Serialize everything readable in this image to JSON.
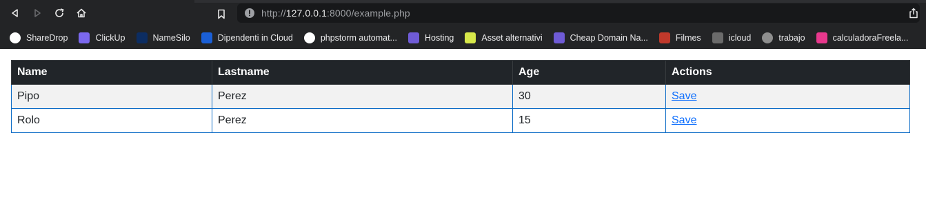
{
  "browser": {
    "url_scheme": "http://",
    "url_host": "127.0.0.1",
    "url_path": ":8000/example.php"
  },
  "bookmarks": [
    {
      "label": "ShareDrop",
      "icon": "sharedrop-icon",
      "color": "#ffffff"
    },
    {
      "label": "ClickUp",
      "icon": "clickup-icon",
      "color": "#7b68ee"
    },
    {
      "label": "NameSilo",
      "icon": "namesilo-icon",
      "color": "#0c2d62"
    },
    {
      "label": "Dipendenti in Cloud",
      "icon": "cloud-icon",
      "color": "#1a5fd6"
    },
    {
      "label": "phpstorm automat...",
      "icon": "google-icon",
      "color": "#ffffff"
    },
    {
      "label": "Hosting",
      "icon": "infinity-icon",
      "color": "#6f5bd6"
    },
    {
      "label": "Asset alternativi",
      "icon": "id-icon",
      "color": "#d7e84a"
    },
    {
      "label": "Cheap Domain Na...",
      "icon": "infinity-icon",
      "color": "#6f5bd6"
    },
    {
      "label": "Filmes",
      "icon": "filmes-icon",
      "color": "#c0392b"
    },
    {
      "label": "icloud",
      "icon": "icloud-photo-icon",
      "color": "#6b6b6b"
    },
    {
      "label": "trabajo",
      "icon": "globe-icon",
      "color": "#8e8e8e"
    },
    {
      "label": "calculadoraFreela...",
      "icon": "calculator-icon",
      "color": "#e8388d"
    }
  ],
  "table": {
    "headers": [
      "Name",
      "Lastname",
      "Age",
      "Actions"
    ],
    "rows": [
      {
        "name": "Pipo",
        "lastname": "Perez",
        "age": "30",
        "action": "Save"
      },
      {
        "name": "Rolo",
        "lastname": "Perez",
        "age": "15",
        "action": "Save"
      }
    ]
  }
}
